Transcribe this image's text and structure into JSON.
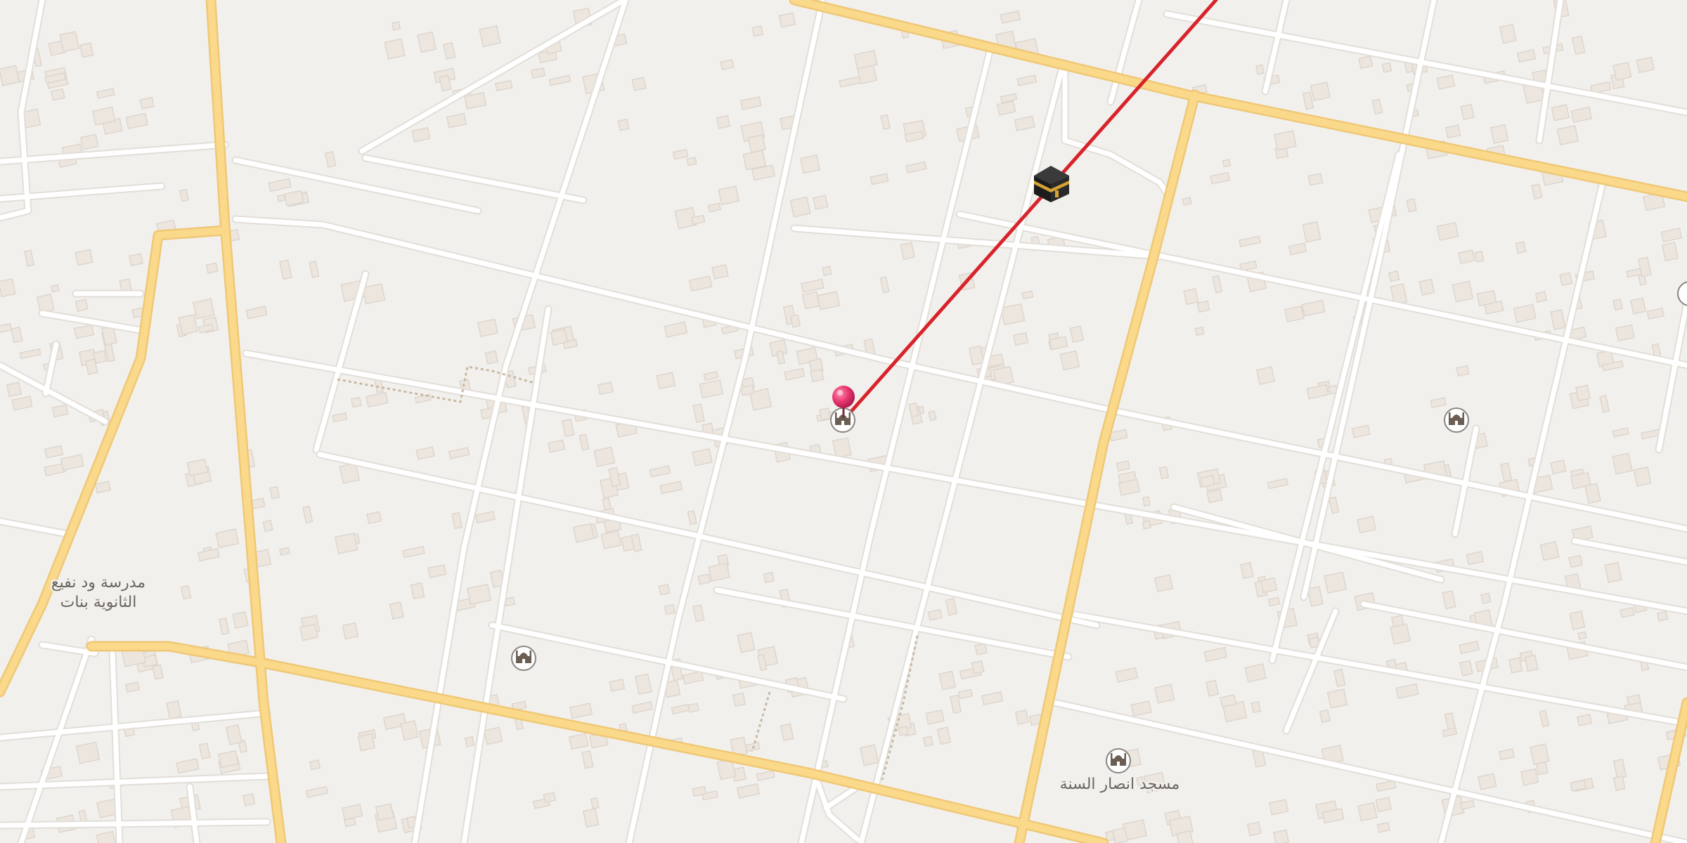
{
  "map": {
    "colors": {
      "background": "#f2f0ed",
      "block": "#f4f2ef",
      "building_fill": "#ece6df",
      "building_stroke": "#ddd6ce",
      "minor_road": "#ffffff",
      "minor_road_casing": "#e2ded8",
      "major_road": "#fbd98a",
      "major_road_casing": "#efc877",
      "path": "#c9b9a3",
      "qibla_line": "#d8232a",
      "pin": "#e8336d",
      "poi_ring": "#8a8580",
      "poi_icon": "#6b5e52"
    },
    "labels": {
      "school_line1": "مدرسة ود نفيع",
      "school_line2": "الثانوية بنات",
      "mosque_name": "مسجد انصار السنة"
    },
    "markers": {
      "kaaba": {
        "icon": "kaaba-icon",
        "interactable": true
      },
      "pin": {
        "icon": "location-pin-icon",
        "interactable": true
      },
      "mosques": [
        {
          "name": "mosque-poi-center",
          "icon": "mosque-icon"
        },
        {
          "name": "mosque-poi-east",
          "icon": "mosque-icon"
        },
        {
          "name": "mosque-poi-west",
          "icon": "mosque-icon"
        },
        {
          "name": "mosque-poi-ansar-alsunna",
          "icon": "mosque-icon"
        }
      ]
    },
    "overlay": {
      "qibla_direction_line": "qibla-line"
    }
  }
}
